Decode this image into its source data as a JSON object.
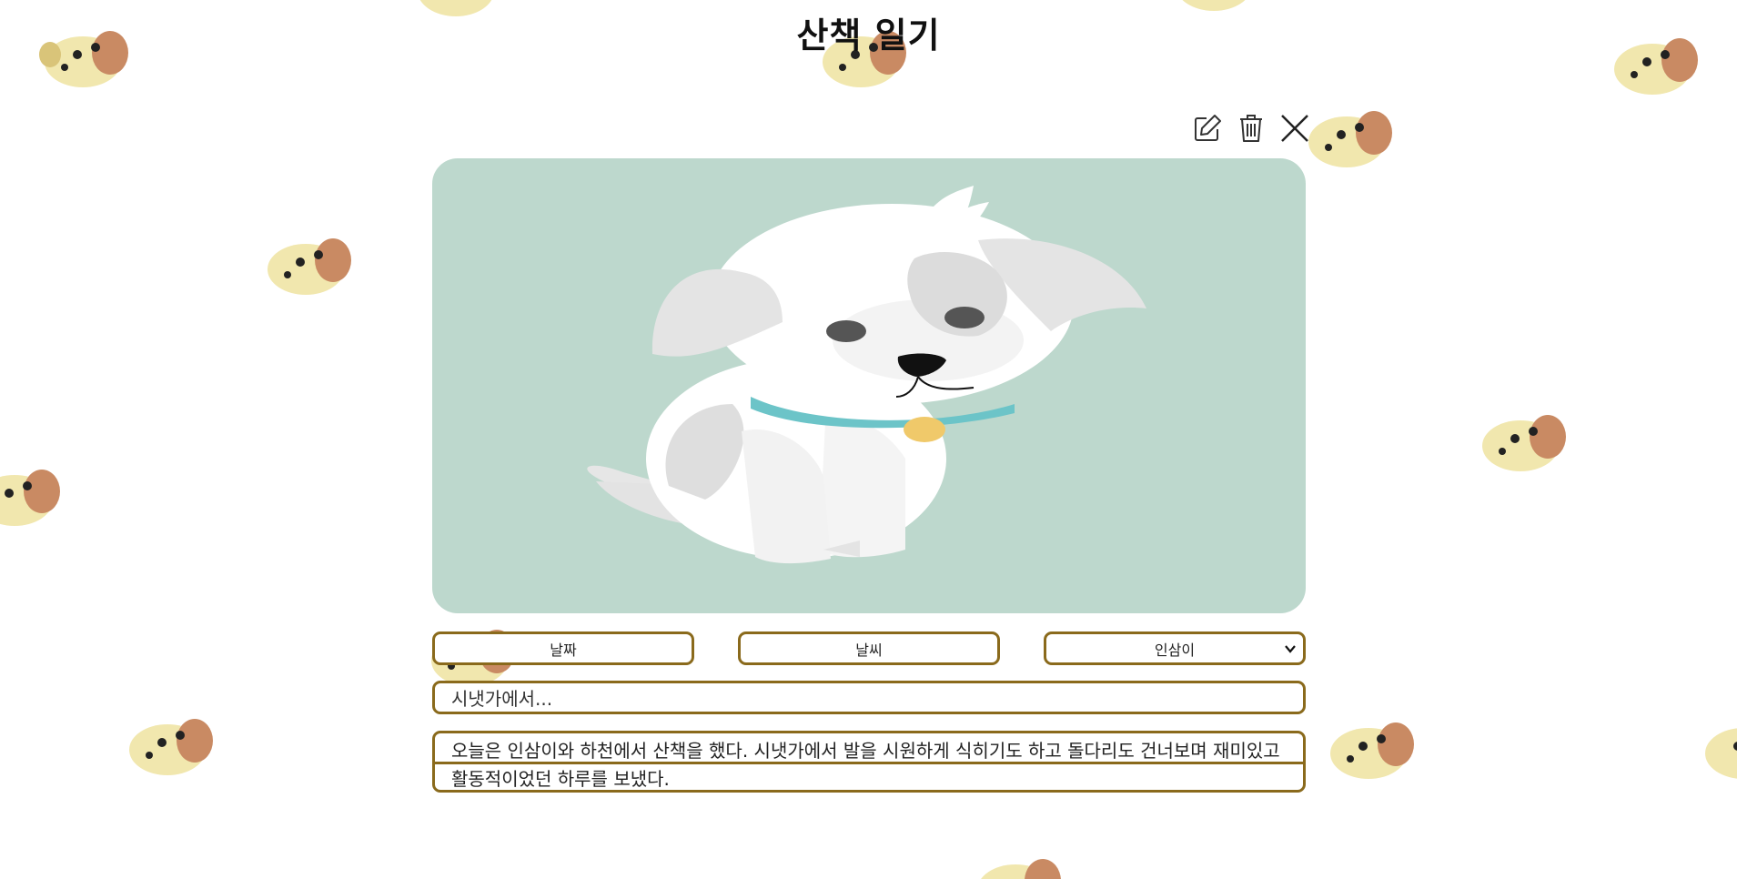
{
  "page": {
    "title": "산책 일기"
  },
  "toolbar": {
    "edit_icon": "pencil-square-icon",
    "delete_icon": "trash-icon",
    "close_icon": "close-x-icon"
  },
  "photo": {
    "subject": "white-puppy-illustration",
    "background_color": "#bdd8cd"
  },
  "fields": {
    "date_placeholder": "날짜",
    "weather_placeholder": "날씨",
    "companion_selected": "인삼이",
    "title_value": "시냇가에서...",
    "body_value": "오늘은 인삼이와 하천에서 산책을 했다. 시냇가에서 발을 시원하게 식히기도 하고 돌다리도 건너보며 재미있고 활동적이었던 하루를 보냈다."
  },
  "colors": {
    "field_border": "#8a6a1c",
    "photo_background": "#bdd8cd",
    "title_text": "#111111"
  }
}
